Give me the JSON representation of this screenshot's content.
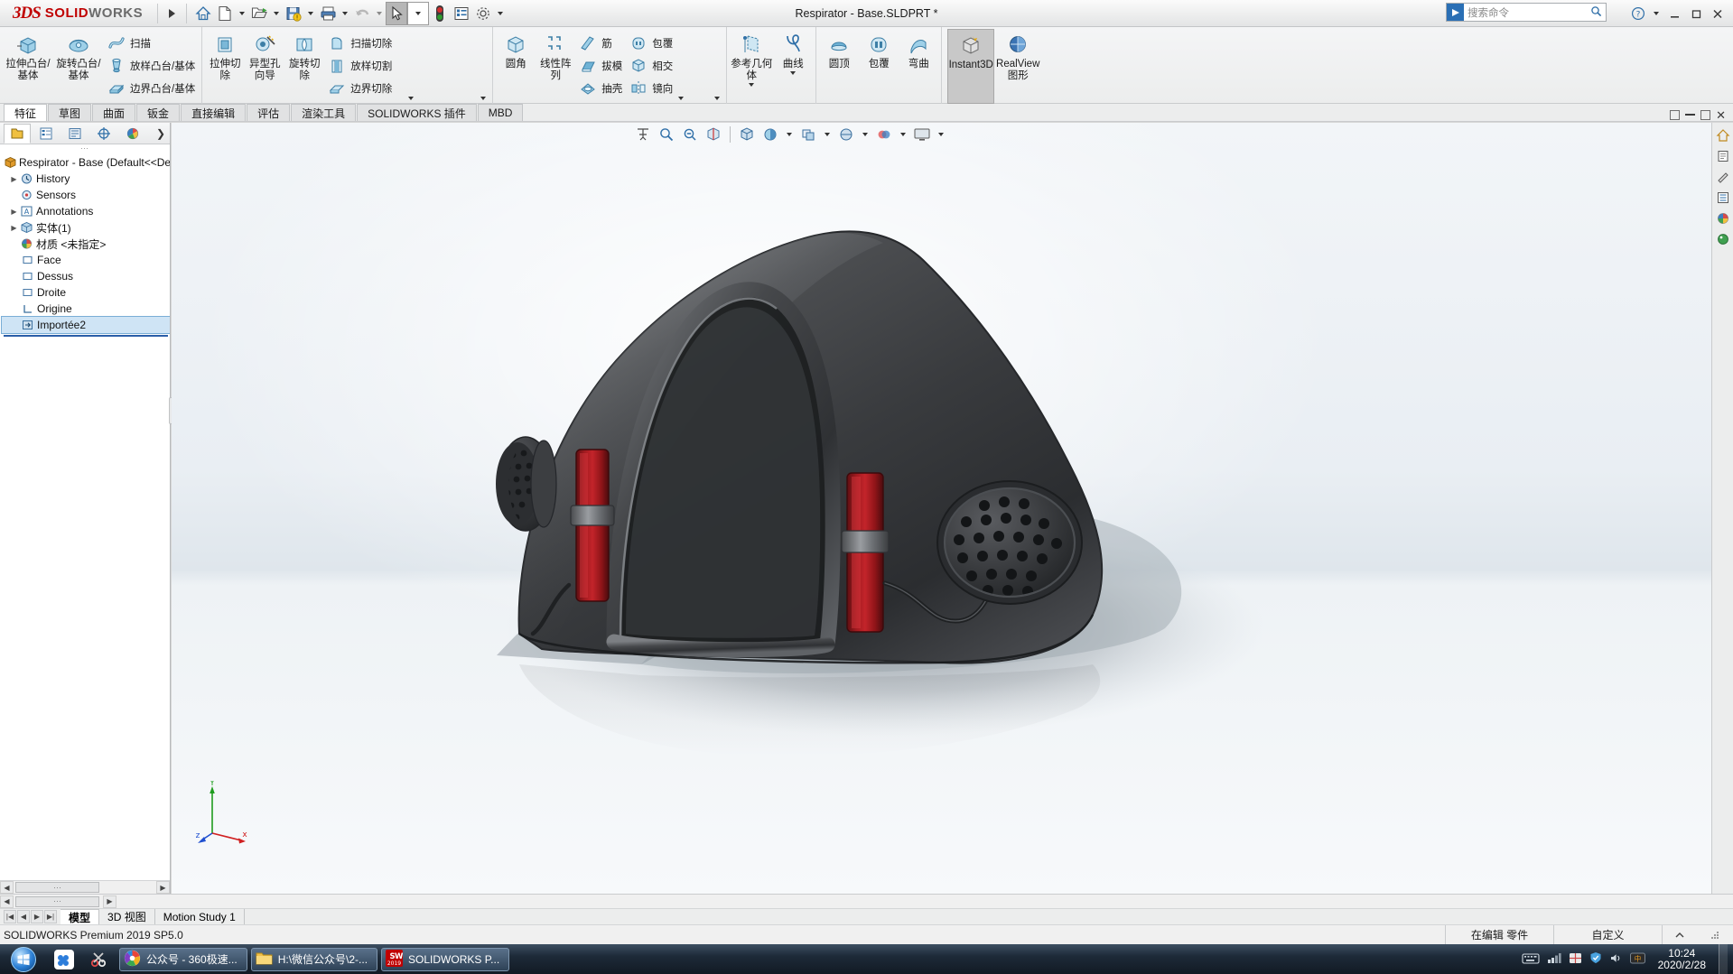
{
  "titlebar": {
    "brand_ds": "3DS",
    "brand_solid": "SOLID",
    "brand_works": "WORKS",
    "document_title": "Respirator - Base.SLDPRT *",
    "search_placeholder": "搜索命令",
    "icons": [
      "home-icon",
      "new-document-icon",
      "open-document-icon",
      "save-icon",
      "print-icon",
      "undo-icon",
      "select-cursor-icon",
      "rebuild-icon",
      "options-list-icon",
      "settings-gear-icon"
    ],
    "window_controls": [
      "help-icon",
      "minimize-icon",
      "restore-icon",
      "close-icon"
    ]
  },
  "ribbon": {
    "groups": [
      {
        "name": "boss-base",
        "big": [
          {
            "label": "拉伸凸台/基体",
            "icon": "extrude-boss-icon"
          },
          {
            "label": "旋转凸台/基体",
            "icon": "revolve-boss-icon"
          }
        ],
        "small": [
          {
            "label": "扫描",
            "icon": "sweep-icon"
          },
          {
            "label": "放样凸台/基体",
            "icon": "loft-boss-icon"
          },
          {
            "label": "边界凸台/基体",
            "icon": "boundary-boss-icon"
          }
        ]
      },
      {
        "name": "cut",
        "big": [
          {
            "label": "拉伸切除",
            "icon": "extrude-cut-icon"
          },
          {
            "label": "异型孔向导",
            "icon": "hole-wizard-icon"
          },
          {
            "label": "旋转切除",
            "icon": "revolve-cut-icon"
          }
        ],
        "small": [
          {
            "label": "扫描切除",
            "icon": "swept-cut-icon"
          },
          {
            "label": "放样切割",
            "icon": "lofted-cut-icon"
          },
          {
            "label": "边界切除",
            "icon": "boundary-cut-icon"
          }
        ]
      },
      {
        "name": "features",
        "big": [
          {
            "label": "圆角",
            "icon": "fillet-icon"
          },
          {
            "label": "线性阵列",
            "icon": "linear-pattern-icon"
          }
        ],
        "small": [
          {
            "label": "筋",
            "icon": "rib-icon"
          },
          {
            "label": "拔模",
            "icon": "draft-icon"
          },
          {
            "label": "抽壳",
            "icon": "shell-icon"
          }
        ],
        "small2": [
          {
            "label": "包覆",
            "icon": "wrap-icon"
          },
          {
            "label": "相交",
            "icon": "intersect-icon"
          },
          {
            "label": "镜向",
            "icon": "mirror-icon"
          }
        ]
      },
      {
        "name": "reference",
        "big": [
          {
            "label": "参考几何体",
            "icon": "reference-geometry-icon"
          },
          {
            "label": "曲线",
            "icon": "curves-icon"
          }
        ]
      },
      {
        "name": "surface-extras",
        "big": [
          {
            "label": "圆顶",
            "icon": "dome-icon"
          },
          {
            "label": "包覆",
            "icon": "wrap2-icon"
          },
          {
            "label": "弯曲",
            "icon": "flex-icon"
          }
        ]
      },
      {
        "name": "display",
        "big": [
          {
            "label": "Instant3D",
            "icon": "instant3d-icon"
          },
          {
            "label": "RealView 图形",
            "icon": "realview-icon"
          }
        ]
      }
    ]
  },
  "tabs": {
    "items": [
      {
        "label": "特征",
        "active": true
      },
      {
        "label": "草图",
        "active": false
      },
      {
        "label": "曲面",
        "active": false
      },
      {
        "label": "钣金",
        "active": false
      },
      {
        "label": "直接编辑",
        "active": false
      },
      {
        "label": "评估",
        "active": false
      },
      {
        "label": "渲染工具",
        "active": false
      },
      {
        "label": "SOLIDWORKS 插件",
        "active": false
      },
      {
        "label": "MBD",
        "active": false
      }
    ]
  },
  "feature_manager": {
    "tab_icons": [
      "feature-tree-icon",
      "property-manager-icon",
      "configuration-manager-icon",
      "dimxpert-icon",
      "display-manager-icon"
    ],
    "more_icon": "chevron-right-icon",
    "tree": [
      {
        "label": "Respirator - Base  (Default<<Defa",
        "icon": "part-icon",
        "expandable": false,
        "indent": 0
      },
      {
        "label": "History",
        "icon": "history-icon",
        "expandable": true,
        "indent": 1
      },
      {
        "label": "Sensors",
        "icon": "sensors-icon",
        "expandable": false,
        "indent": 1
      },
      {
        "label": "Annotations",
        "icon": "annotations-icon",
        "expandable": true,
        "indent": 1
      },
      {
        "label": "实体(1)",
        "icon": "solid-bodies-icon",
        "expandable": true,
        "indent": 1
      },
      {
        "label": "材质 <未指定>",
        "icon": "material-icon",
        "expandable": false,
        "indent": 1
      },
      {
        "label": "Face",
        "icon": "plane-icon",
        "expandable": false,
        "indent": 1
      },
      {
        "label": "Dessus",
        "icon": "plane-icon",
        "expandable": false,
        "indent": 1
      },
      {
        "label": "Droite",
        "icon": "plane-icon",
        "expandable": false,
        "indent": 1
      },
      {
        "label": "Origine",
        "icon": "origin-icon",
        "expandable": false,
        "indent": 1
      },
      {
        "label": "Importée2",
        "icon": "imported-feature-icon",
        "expandable": false,
        "indent": 1,
        "selected": true
      }
    ]
  },
  "view_toolbar": {
    "icons": [
      "zoom-to-fit-icon",
      "zoom-to-area-icon",
      "previous-view-icon",
      "section-view-icon",
      "view-orientation-icon",
      "display-style-icon",
      "hide-show-icon",
      "apply-scene-icon",
      "view-settings-icon",
      "display-pane-icon",
      "full-screen-icon"
    ]
  },
  "right_toolbar": {
    "icons": [
      "home-view-icon",
      "note-icon",
      "edit-icon",
      "list-icon",
      "appearance-icon",
      "palette-icon"
    ]
  },
  "triad": {
    "x_label": "x",
    "y_label": "Y",
    "z_label": "z"
  },
  "bottom_tabs": {
    "items": [
      {
        "label": "模型",
        "active": true
      },
      {
        "label": "3D 视图",
        "active": false
      },
      {
        "label": "Motion Study 1",
        "active": false
      }
    ]
  },
  "statusbar": {
    "version": "SOLIDWORKS Premium 2019 SP5.0",
    "editing": "在编辑 零件",
    "custom": "自定义",
    "caret": "chevron-up-icon"
  },
  "taskbar": {
    "start_label": "start-orb",
    "quick_icons": [
      "baidu-netdisk-icon",
      "snip-tool-icon"
    ],
    "items": [
      {
        "label": "公众号 - 360极速...",
        "icon": "browser-360-icon"
      },
      {
        "label": "H:\\微信公众号\\2-...",
        "icon": "folder-icon"
      },
      {
        "label": "SOLIDWORKS P...",
        "icon": "solidworks-app-icon"
      }
    ],
    "tray_icons": [
      "keyboard-icon",
      "network-icon",
      "flag-icon",
      "shield-icon",
      "volume-icon",
      "ime-icon"
    ],
    "clock_time": "10:24",
    "clock_date": "2020/2/28"
  }
}
